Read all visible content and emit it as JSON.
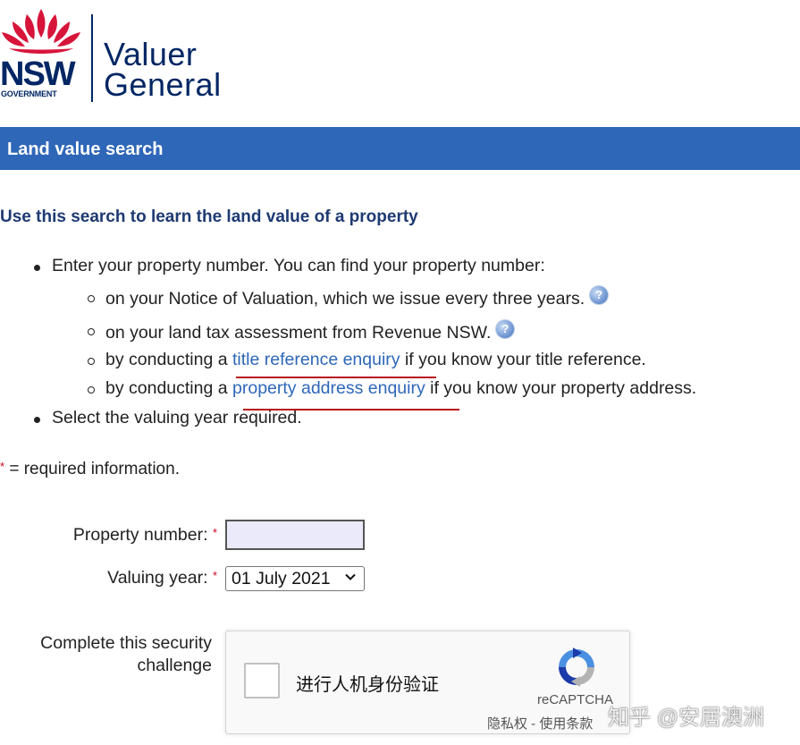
{
  "brand": {
    "nsw": "NSW",
    "government": "GOVERNMENT",
    "title_line1": "Valuer",
    "title_line2": "General"
  },
  "banner": {
    "title": "Land value search"
  },
  "lead": "Use this search to learn the land value of a property",
  "instructions": {
    "item1": "Enter your property number. You can find your property number:",
    "sub1": "on your Notice of Valuation, which we issue every three years.",
    "sub2": "on your land tax assessment from Revenue NSW.",
    "sub3_pre": "by conducting a ",
    "sub3_link": "title reference enquiry",
    "sub3_post": " if you know your title reference.",
    "sub4_pre": "by conducting a ",
    "sub4_link": "property address enquiry",
    "sub4_post": " if you know your property address.",
    "item2": "Select the valuing year required.",
    "help_glyph": "?"
  },
  "required_note": {
    "star": "*",
    "text": " = required information."
  },
  "form": {
    "property_number_label": "Property number:",
    "property_number_value": "",
    "valuing_year_label": "Valuing year:",
    "valuing_year_selected": "01 July 2021",
    "required_star": "*",
    "security_label_line1": "Complete this security",
    "security_label_line2": "challenge"
  },
  "captcha": {
    "label": "进行人机身份验证",
    "brand": "reCAPTCHA",
    "links": "隐私权 - 使用条款"
  },
  "watermark": "知乎 @安居澳洲",
  "colors": {
    "banner": "#2e67b8",
    "link": "#2e67b8",
    "heading": "#1e3a72",
    "underline_annotation": "#b8141c",
    "required": "#d0021b",
    "brand_navy": "#002664",
    "brand_red": "#d7153a"
  }
}
